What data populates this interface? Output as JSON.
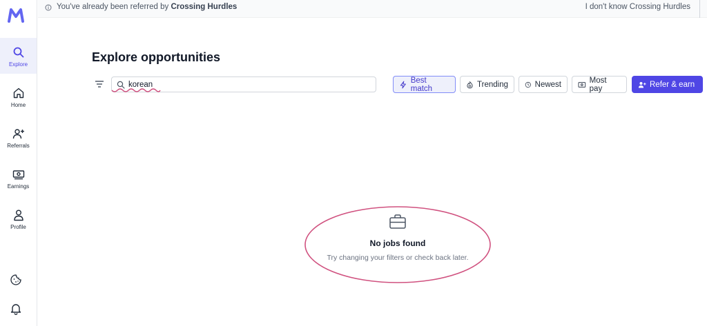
{
  "banner": {
    "referral_prefix": "You've already been referred by",
    "referrer": "Crossing Hurdles",
    "dont_know": "I don't know Crossing Hurdles"
  },
  "sidebar": {
    "logo": "M",
    "items": [
      {
        "label": "Explore",
        "icon": "search-icon"
      },
      {
        "label": "Home",
        "icon": "home-icon"
      },
      {
        "label": "Referrals",
        "icon": "add-user-icon"
      },
      {
        "label": "Earnings",
        "icon": "money-icon"
      },
      {
        "label": "Profile",
        "icon": "user-icon"
      }
    ],
    "bottom_icons": [
      "cookie-icon",
      "bell-icon"
    ]
  },
  "main": {
    "title": "Explore opportunities",
    "search": {
      "value": "korean"
    },
    "sort_options": [
      "Best match",
      "Trending",
      "Newest",
      "Most pay"
    ],
    "active_sort": "Best match",
    "refer_button": "Refer & earn",
    "empty_state": {
      "title": "No jobs found",
      "subtitle": "Try changing your filters or check back later."
    }
  },
  "colors": {
    "accent": "#4f46e5",
    "active_bg": "#eef0fb",
    "annotation": "#d0517f"
  }
}
